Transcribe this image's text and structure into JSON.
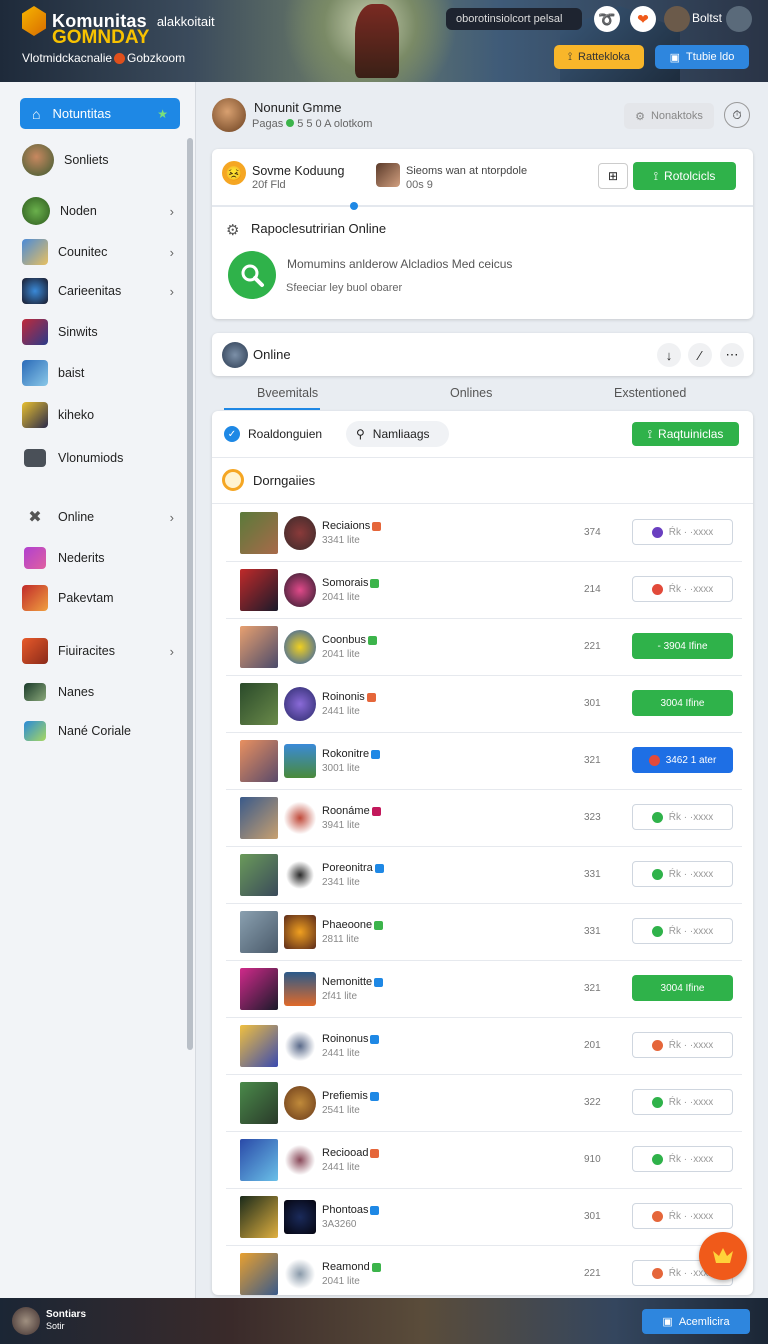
{
  "header": {
    "brand": "Komunitas",
    "brand_sub": "alakkoitait",
    "brand_line2": "GOMNDAY",
    "tagline_a": "Vlotmidckacnalie",
    "tagline_b": "Gobzkoom",
    "search_text": "oborotinsiolcort pelsal",
    "user_label": "Boltst",
    "btn_yellow": "Rattekloka",
    "btn_blue": "Ttubie ldo"
  },
  "sidebar": {
    "home_label": "Notuntitas",
    "items": [
      {
        "label": "Sonliets"
      },
      {
        "label": "Noden"
      },
      {
        "label": "Counitec"
      },
      {
        "label": "Carieenitas"
      },
      {
        "label": "Sinwits"
      },
      {
        "label": "baist"
      },
      {
        "label": "kiheko"
      },
      {
        "label": "Vlonumiods"
      },
      {
        "label": "Online"
      },
      {
        "label": "Nederits"
      },
      {
        "label": "Pakevtam"
      },
      {
        "label": "Fiuiracites"
      },
      {
        "label": "Nanes"
      },
      {
        "label": "Nané Coriale"
      }
    ]
  },
  "main": {
    "title": "Nonunit Gmme",
    "sub_a": "Pagas",
    "sub_b": "5 5 0 A olotkom",
    "notif_btn": "Nonaktoks",
    "card1": {
      "item1_title": "Sovme Koduung",
      "item1_sub": "20f Fld",
      "item2_title": "Sieoms wan at ntorpdole",
      "item2_sub": "00s 9",
      "action_btn": "Rotolcicls",
      "section_title": "Rapoclesutririan Online",
      "desc": "Momumins anlderow Alcladios Med ceicus",
      "desc2": "Sfeeciar ley buol obarer"
    },
    "card2_title": "Online",
    "tabs": [
      "Bveemitals",
      "Onlines",
      "Exstentioned"
    ],
    "filter1": "Roaldonguien",
    "filter2": "Namliaags",
    "panel_btn": "Raqtuiniclas",
    "section": "Dorngaiies"
  },
  "rows": [
    {
      "name": "Reciaions",
      "badge": "#e5663a",
      "meta": "3341 lite",
      "num": "374",
      "action": "Ŕk · ·xxxx",
      "style": "outline",
      "dot": "#6a3fc0"
    },
    {
      "name": "Somorais",
      "badge": "#3cb44b",
      "meta": "2041 lite",
      "num": "214",
      "action": "Ŕk · ·xxxx",
      "style": "outline",
      "dot": "#e24a3a"
    },
    {
      "name": "Coonbus",
      "badge": "#3cb44b",
      "meta": "2041 lite",
      "num": "221",
      "action": "- 3904 Ifine",
      "style": "green",
      "dot": ""
    },
    {
      "name": "Roinonis",
      "badge": "#e5663a",
      "meta": "2441 lite",
      "num": "301",
      "action": "3004 Ifine",
      "style": "green",
      "dot": ""
    },
    {
      "name": "Rokonitre",
      "badge": "#1e88e5",
      "meta": "3001 lite",
      "num": "321",
      "action": "3462 1 ater",
      "style": "blue",
      "dot": "#e24a3a"
    },
    {
      "name": "Roonáme",
      "badge": "#c2185b",
      "meta": "3941 lite",
      "num": "323",
      "action": "Ŕk · ·xxxx",
      "style": "outline",
      "dot": "#2fb24a"
    },
    {
      "name": "Poreonitra",
      "badge": "#1e88e5",
      "meta": "2341 lite",
      "num": "331",
      "action": "Ŕk · ·xxxx",
      "style": "outline",
      "dot": "#2fb24a"
    },
    {
      "name": "Phaeoone",
      "badge": "#3cb44b",
      "meta": "2811 lite",
      "num": "331",
      "action": "Ŕk · ·xxxx",
      "style": "outline",
      "dot": "#2fb24a"
    },
    {
      "name": "Nemonitte",
      "badge": "#1e88e5",
      "meta": "2f41 lite",
      "num": "321",
      "action": "3004 Ifine",
      "style": "green",
      "dot": ""
    },
    {
      "name": "Roinonus",
      "badge": "#1e88e5",
      "meta": "2441 lite",
      "num": "201",
      "action": "Ŕk · ·xxxx",
      "style": "outline",
      "dot": "#e5663a"
    },
    {
      "name": "Prefiemis",
      "badge": "#1e88e5",
      "meta": "2541 lite",
      "num": "322",
      "action": "Ŕk · ·xxxx",
      "style": "outline",
      "dot": "#2fb24a"
    },
    {
      "name": "Reciooad",
      "badge": "#e5663a",
      "meta": "2441 lite",
      "num": "910",
      "action": "Ŕk · ·xxxx",
      "style": "outline",
      "dot": "#2fb24a"
    },
    {
      "name": "Phontoas",
      "badge": "#1e88e5",
      "meta": "3A3260",
      "num": "301",
      "action": "Ŕk · ·xxxx",
      "style": "outline",
      "dot": "#e5663a"
    },
    {
      "name": "Reamond",
      "badge": "#3cb44b",
      "meta": "2041 lite",
      "num": "221",
      "action": "Ŕk · ·xxxx",
      "style": "outline",
      "dot": "#e5663a"
    }
  ],
  "footer": {
    "title": "Sontiars",
    "sub": "Sotir",
    "btn": "Acemlicira"
  }
}
